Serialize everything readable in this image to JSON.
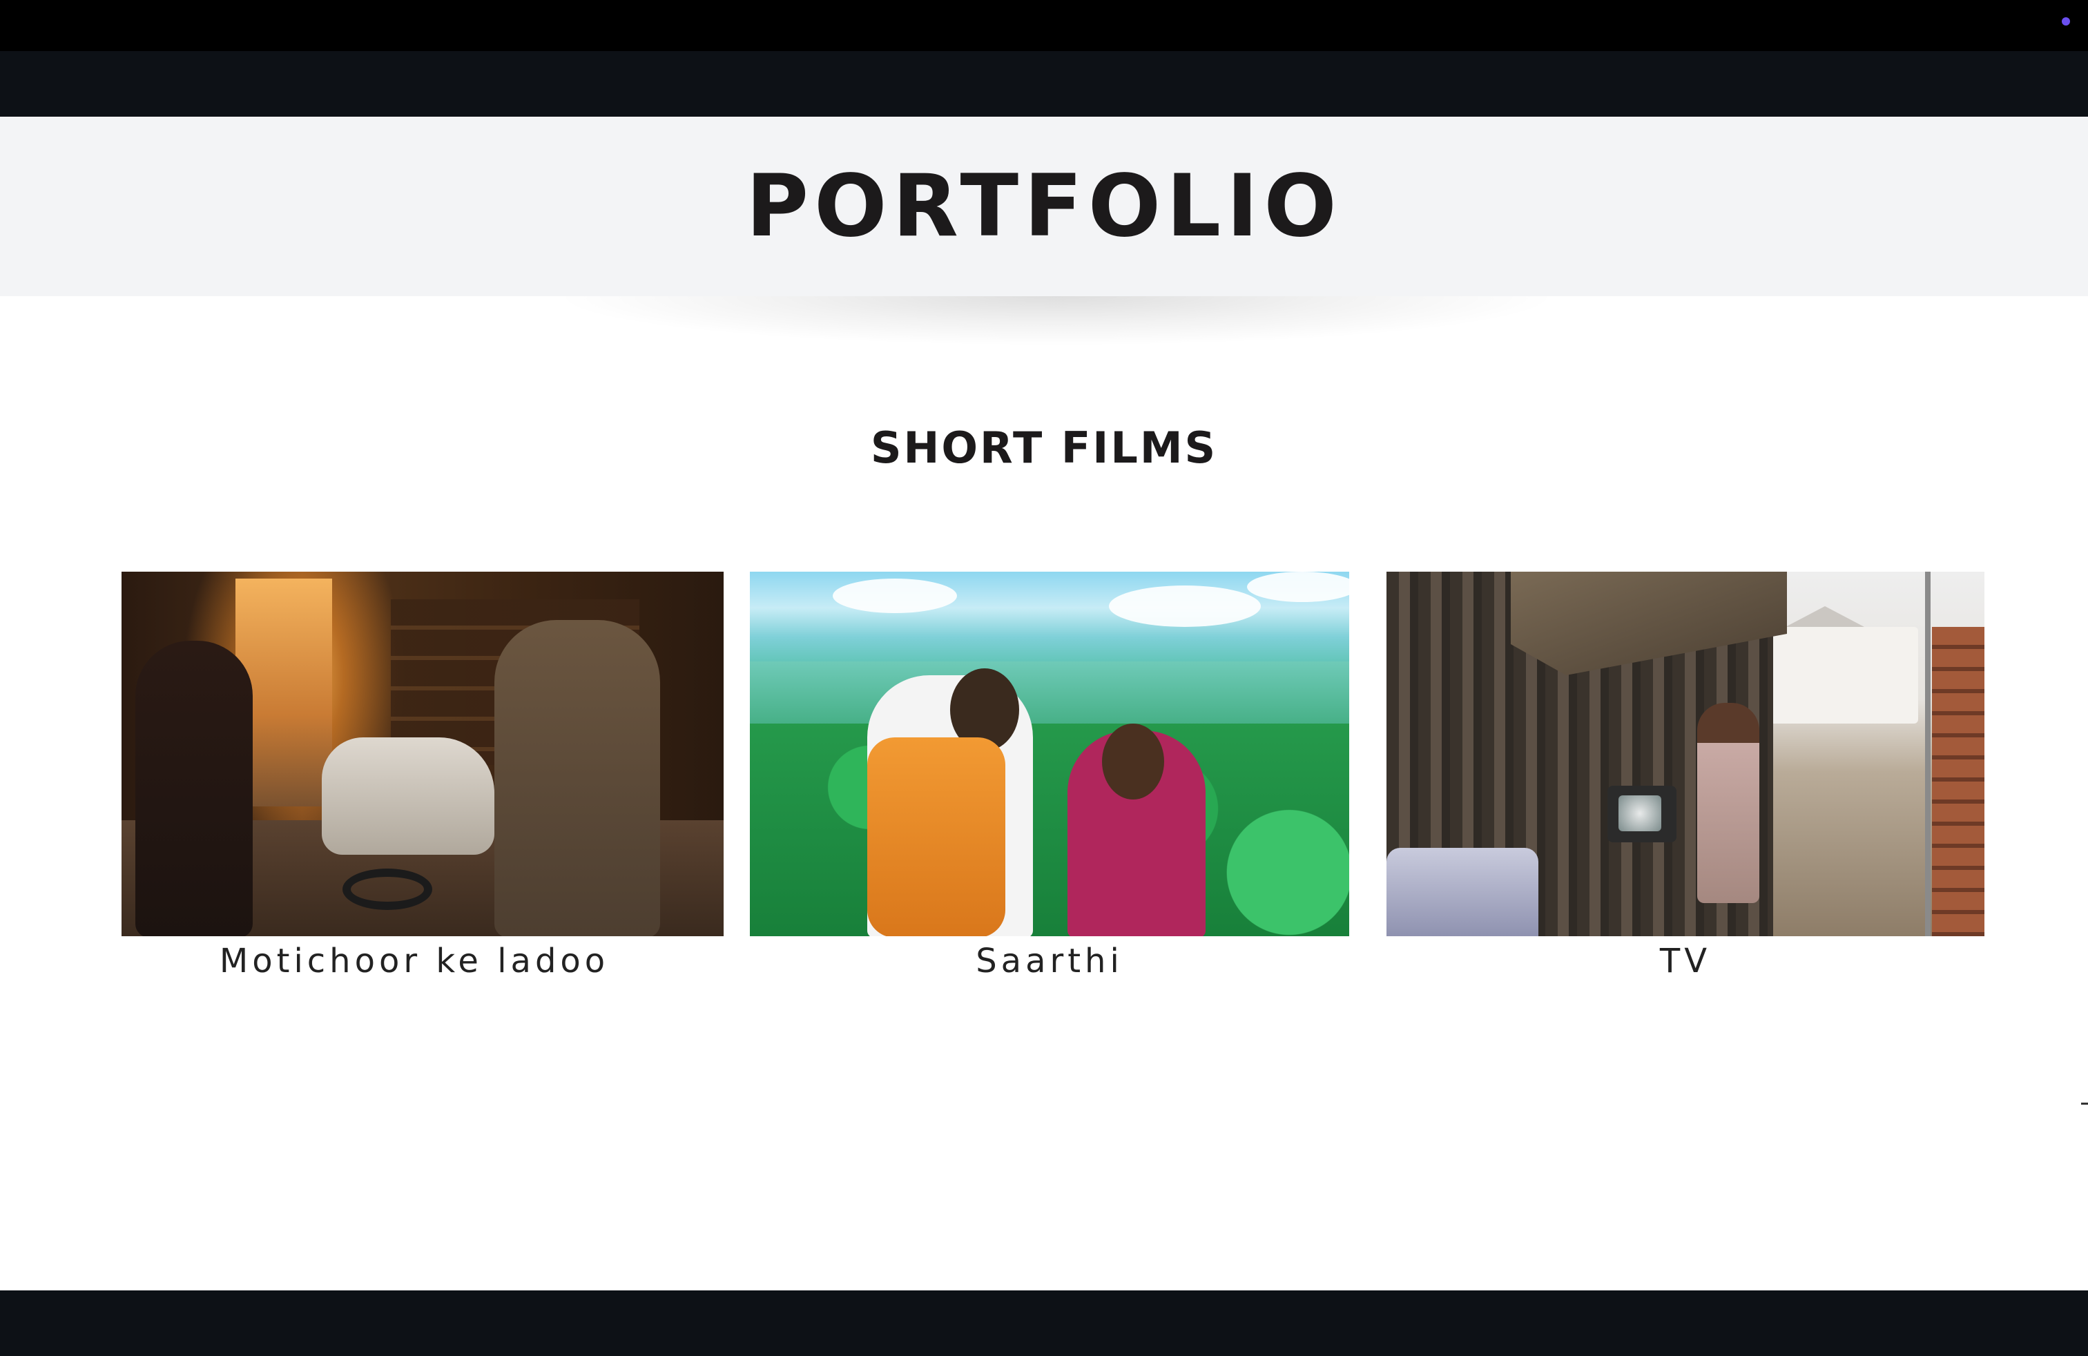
{
  "hero": {
    "title": "PORTFOLIO"
  },
  "section": {
    "title": "SHORT FILMS"
  },
  "films": [
    {
      "title": "Motichoor ke ladoo",
      "thumbnail_icon": "garage-scene-image"
    },
    {
      "title": "Saarthi",
      "thumbnail_icon": "jungle-vista-image"
    },
    {
      "title": "TV",
      "thumbnail_icon": "hut-and-house-image"
    }
  ],
  "colors": {
    "top_strip": "#000000",
    "navbar": "#0d1116",
    "hero_background": "#f3f4f6",
    "heading_text": "#1c1a1b",
    "page_background": "#ffffff",
    "accent_dot": "#6a4ff0"
  }
}
